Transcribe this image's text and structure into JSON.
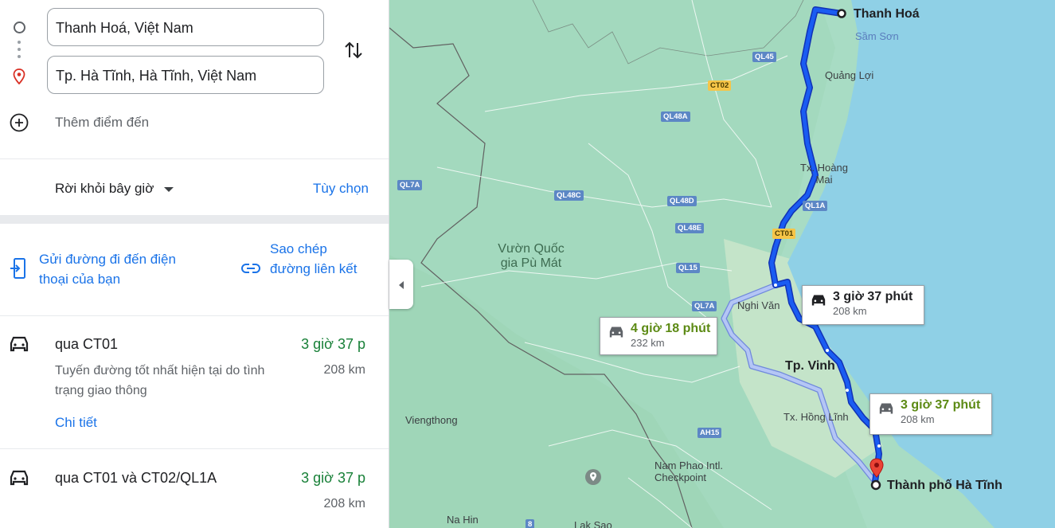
{
  "directions": {
    "origin": "Thanh Hoá, Việt Nam",
    "destination": "Tp. Hà Tĩnh, Hà Tĩnh, Việt Nam",
    "add_stop": "Thêm điểm đến"
  },
  "depart": {
    "label": "Rời khỏi bây giờ",
    "options": "Tùy chọn"
  },
  "share": {
    "send_to_phone": "Gửi đường đi đến điện thoại của bạn",
    "copy_link": "Sao chép đường liên kết"
  },
  "routes": [
    {
      "name": "qua CT01",
      "time": "3 giờ 37 p",
      "desc": "Tuyến đường tốt nhất hiện tại do tình trạng giao thông",
      "distance": "208 km",
      "details": "Chi tiết"
    },
    {
      "name": "qua CT01 và CT02/QL1A",
      "time": "3 giờ 37 p",
      "distance": "208 km"
    }
  ],
  "map": {
    "places": {
      "thanh_hoa": "Thanh Hoá",
      "sam_son": "Sầm Sơn",
      "quang_loi": "Quảng Lợi",
      "hoang_mai": "Tx. Hoàng Mai",
      "pu_mat": "Vườn Quốc gia Pù Mát",
      "nghi_van": "Nghi Văn",
      "vinh": "Tp. Vinh",
      "hong_linh": "Tx. Hồng Lĩnh",
      "viengthong": "Viengthong",
      "nam_phao": "Nam Phao Intl. Checkpoint",
      "ha_tinh": "Thành phố Hà Tĩnh",
      "na_hin": "Na Hin",
      "lak_sao": "Lak Sao"
    },
    "roads": {
      "ql45": "QL45",
      "ct02": "CT02",
      "ql48a": "QL48A",
      "ql7a_w": "QL7A",
      "ql48c": "QL48C",
      "ql48d": "QL48D",
      "ql48e": "QL48E",
      "ql1a": "QL1A",
      "ct01": "CT01",
      "ql15": "QL15",
      "ql7a": "QL7A",
      "ah15": "AH15",
      "r8": "8"
    },
    "callouts": [
      {
        "time": "3 giờ 37 phút",
        "distance": "208 km"
      },
      {
        "time": "4 giờ 18 phút",
        "distance": "232 km"
      },
      {
        "time": "3 giờ 37 phút",
        "distance": "208 km"
      }
    ]
  },
  "colors": {
    "route_primary": "#1a4bd6",
    "route_alt": "#8ea8ea",
    "time_green": "#188038",
    "link_blue": "#1a73e8",
    "water": "#8fd0e6",
    "land": "#a8dcc4"
  }
}
